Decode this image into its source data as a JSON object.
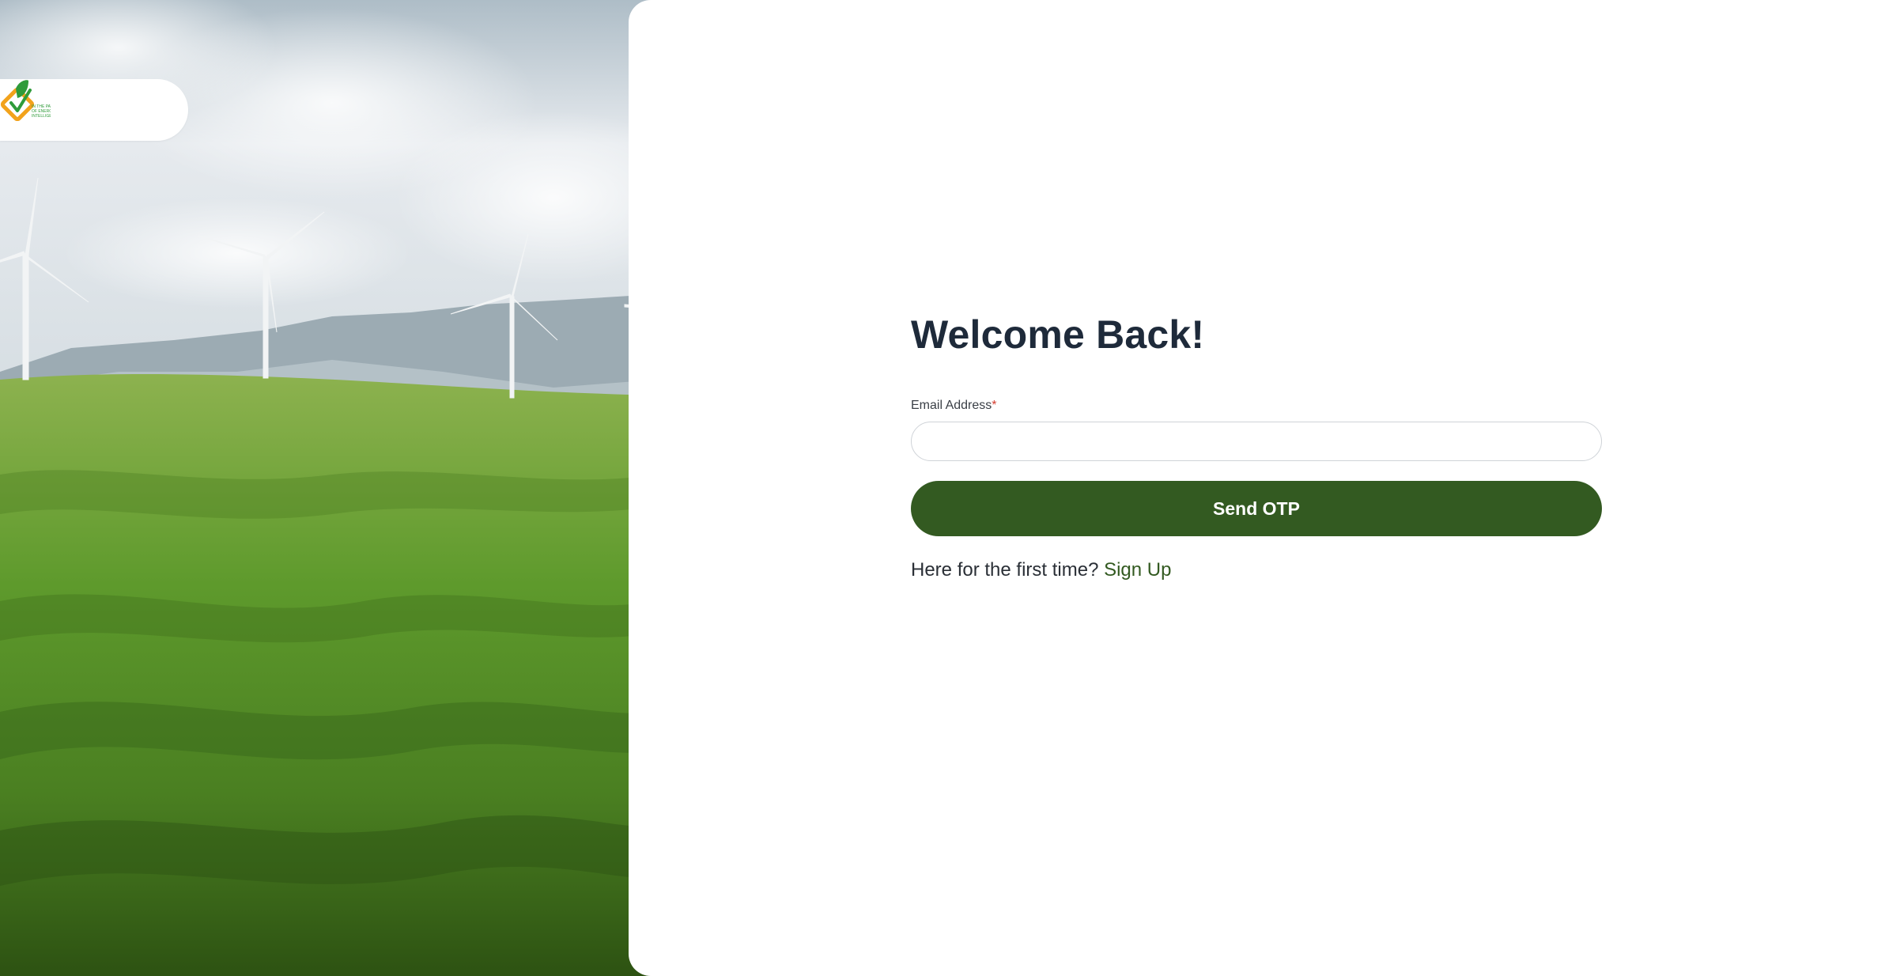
{
  "brand": {
    "logo_icon": "leaf-check-logo-icon",
    "logo_text": "IN THE PATHWAY OF ENERGY INTELLIGENCE"
  },
  "hero": {
    "image": "wind-turbines-green-hills-landscape"
  },
  "login": {
    "title": "Welcome Back!",
    "email_label": "Email Address",
    "required_marker": "*",
    "email_value": "",
    "email_placeholder": "",
    "send_otp_label": "Send OTP",
    "first_time_text": "Here for the first time?",
    "sign_up_label": "Sign Up"
  },
  "colors": {
    "primary": "#335a21",
    "title": "#1e2a3a",
    "required": "#d33b2e",
    "input_border": "#cfd3d8"
  }
}
